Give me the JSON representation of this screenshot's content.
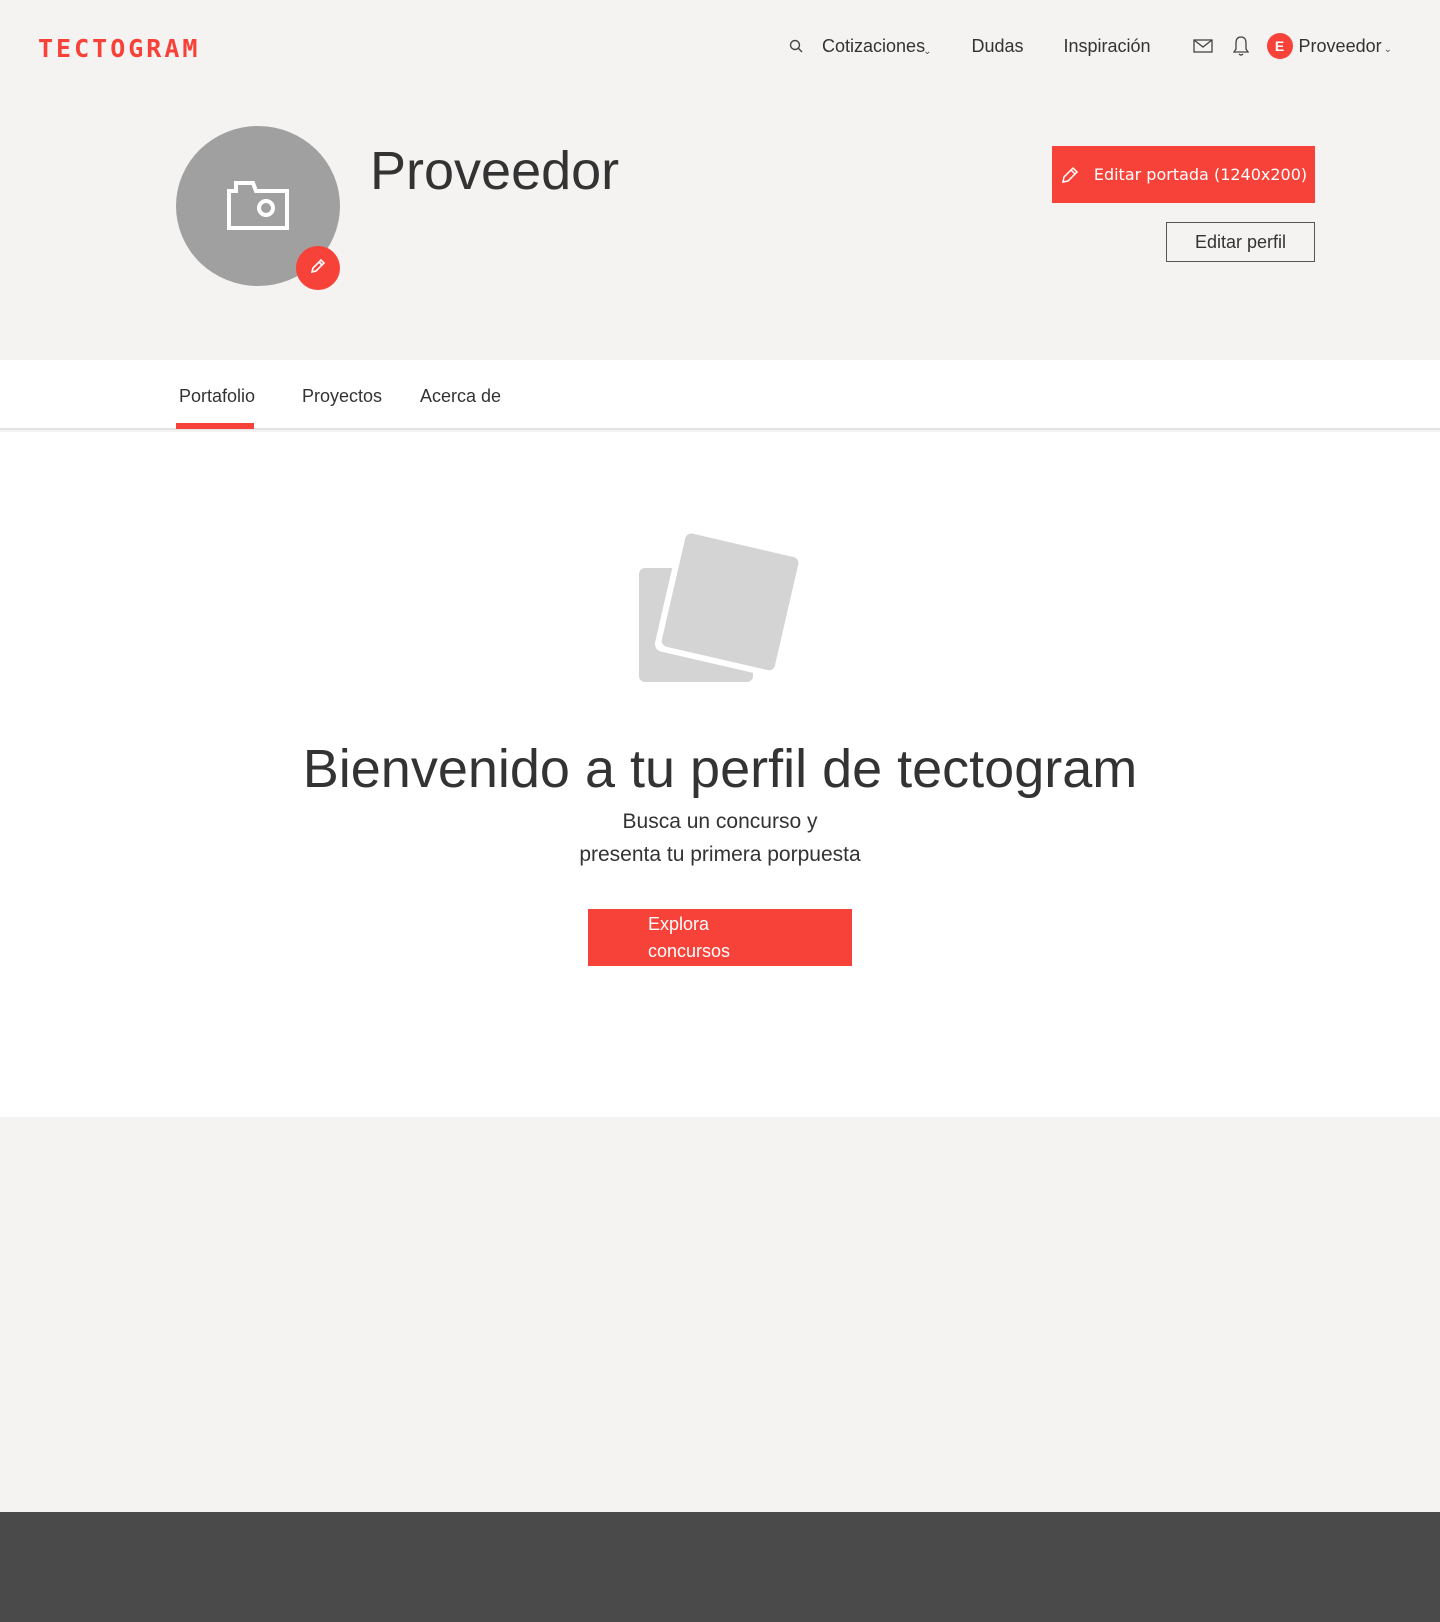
{
  "brand": {
    "logo_text": "TECTOGRAM",
    "accent_color": "#f7423a"
  },
  "nav": {
    "search_icon": "search-icon",
    "links": [
      {
        "label": "Cotizaciones",
        "has_dropdown": true
      },
      {
        "label": "Dudas",
        "has_dropdown": true
      },
      {
        "label": "Inspiración",
        "has_dropdown": false
      }
    ],
    "mail_icon": "mail-icon",
    "bell_icon": "bell-icon",
    "user": {
      "initial": "E",
      "name": "Proveedor"
    }
  },
  "profile": {
    "name": "Proveedor",
    "avatar_icon": "camera-icon",
    "edit_cover_label": "Editar portada (1240x200)",
    "edit_profile_label": "Editar perfil"
  },
  "tabs": [
    {
      "label": "Portafolio",
      "active": true
    },
    {
      "label": "Proyectos",
      "active": false
    },
    {
      "label": "Acerca de",
      "active": false
    }
  ],
  "empty_state": {
    "icon": "photos-icon",
    "title": "Bienvenido a tu perfil de tectogram",
    "subtitle_line1": "Busca un concurso y",
    "subtitle_line2": "presenta tu primera porpuesta",
    "button_label": "Explora concursos"
  }
}
